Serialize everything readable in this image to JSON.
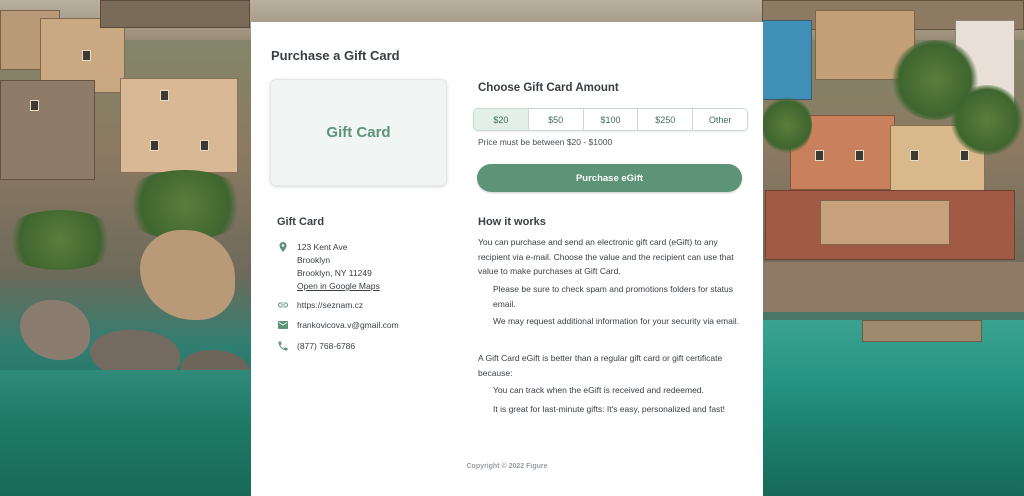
{
  "page": {
    "title": "Purchase a Gift Card"
  },
  "gift_tile": {
    "label": "Gift Card"
  },
  "amount": {
    "title": "Choose Gift Card Amount",
    "options": [
      "$20",
      "$50",
      "$100",
      "$250",
      "Other"
    ],
    "selected": "$20",
    "note": "Price must be between $20 - $1000"
  },
  "purchase_button": "Purchase eGift",
  "business": {
    "heading": "Gift Card",
    "address_line1": "123 Kent Ave",
    "address_line2": "Brooklyn",
    "address_line3": "Brooklyn, NY 11249",
    "maps_link": "Open in Google Maps",
    "website": "https://seznam.cz",
    "email": "frankovicova.v@gmail.com",
    "phone": "(877) 768-6786"
  },
  "how_it_works": {
    "heading": "How it works",
    "intro": "You can purchase and send an electronic gift card (eGift) to any recipient via e-mail. Choose the value and the recipient can use that value to make purchases at Gift Card.",
    "note1": "Please be sure to check spam and promotions folders for status email.",
    "note2": "We may request additional information for your security via email.",
    "better": "A Gift Card eGift is better than a regular gift card or gift certificate because:",
    "benefit1": "You can track when the eGift is received and redeemed.",
    "benefit2": "It is great for last-minute gifts: It's easy, personalized and fast!"
  },
  "footer": "Copyright © 2022 Figure",
  "colors": {
    "accent": "#5d9478",
    "accent_light": "#e3efe9"
  },
  "icons": [
    "location-pin-icon",
    "link-icon",
    "mail-icon",
    "phone-icon"
  ]
}
